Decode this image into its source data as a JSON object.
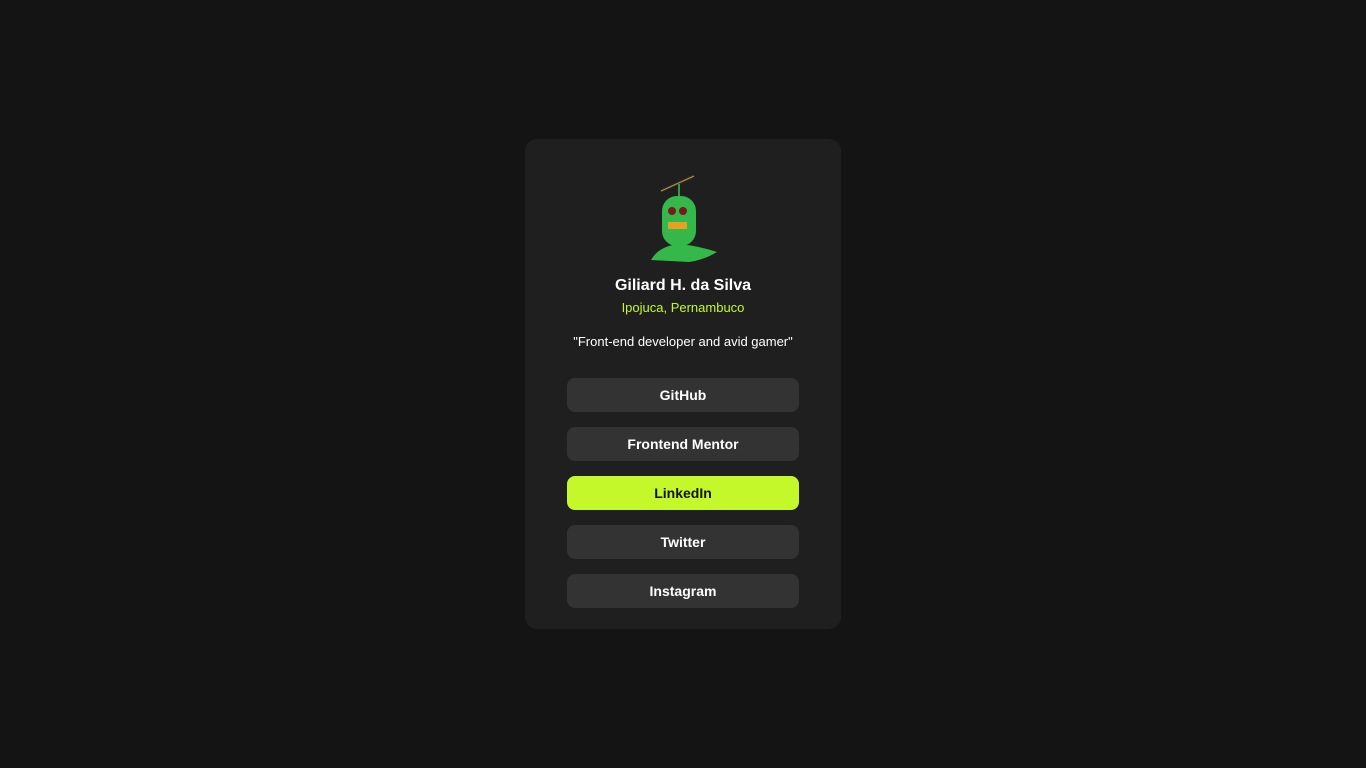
{
  "profile": {
    "name": "Giliard H. da Silva",
    "location": "Ipojuca, Pernambuco",
    "bio": "\"Front-end developer and avid gamer\"",
    "avatar": "robot-avatar"
  },
  "links": [
    {
      "label": "GitHub"
    },
    {
      "label": "Frontend Mentor"
    },
    {
      "label": "LinkedIn"
    },
    {
      "label": "Twitter"
    },
    {
      "label": "Instagram"
    }
  ],
  "colors": {
    "accent": "#c4f82a",
    "background": "#141414",
    "card": "#1f1f1f",
    "button": "#333333"
  }
}
